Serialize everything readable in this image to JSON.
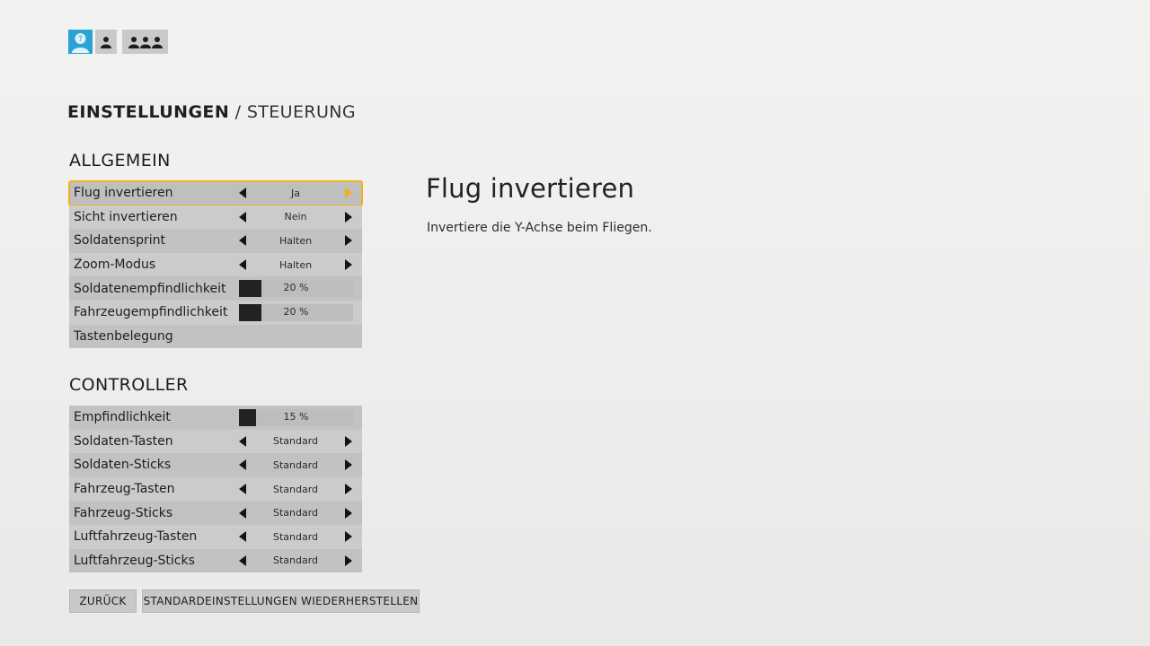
{
  "top_nav": {
    "help_icon": "question-person-icon",
    "solo_icon": "single-person-icon",
    "group_icon": "group-icon"
  },
  "breadcrumb": {
    "section": "EINSTELLUNGEN",
    "separator": " / ",
    "page": "STEUERUNG"
  },
  "allgemein": {
    "title": "ALLGEMEIN",
    "rows": [
      {
        "label": "Flug invertieren",
        "type": "selector",
        "value": "Ja",
        "focused": true
      },
      {
        "label": "Sicht invertieren",
        "type": "selector",
        "value": "Nein"
      },
      {
        "label": "Soldatensprint",
        "type": "selector",
        "value": "Halten"
      },
      {
        "label": "Zoom-Modus",
        "type": "selector",
        "value": "Halten"
      },
      {
        "label": "Soldatenempfindlichkeit",
        "type": "slider",
        "value": "20 %",
        "level": 0.2
      },
      {
        "label": "Fahrzeugempfindlichkeit",
        "type": "slider",
        "value": "20 %",
        "level": 0.2
      },
      {
        "label": "Tastenbelegung",
        "type": "link"
      }
    ]
  },
  "controller": {
    "title": "CONTROLLER",
    "rows": [
      {
        "label": "Empfindlichkeit",
        "type": "slider",
        "value": "15 %",
        "level": 0.15
      },
      {
        "label": "Soldaten-Tasten",
        "type": "selector",
        "value": "Standard"
      },
      {
        "label": "Soldaten-Sticks",
        "type": "selector",
        "value": "Standard"
      },
      {
        "label": "Fahrzeug-Tasten",
        "type": "selector",
        "value": "Standard"
      },
      {
        "label": "Fahrzeug-Sticks",
        "type": "selector",
        "value": "Standard"
      },
      {
        "label": "Luftfahrzeug-Tasten",
        "type": "selector",
        "value": "Standard"
      },
      {
        "label": "Luftfahrzeug-Sticks",
        "type": "selector",
        "value": "Standard"
      }
    ]
  },
  "detail": {
    "title": "Flug invertieren",
    "description": "Invertiere die Y-Achse beim Fliegen."
  },
  "buttons": {
    "back": "ZURÜCK",
    "reset": "STANDARDEINSTELLUNGEN WIEDERHERSTELLEN"
  },
  "colors": {
    "focus": "#f2b21c",
    "help_blue": "#29a3d4"
  }
}
